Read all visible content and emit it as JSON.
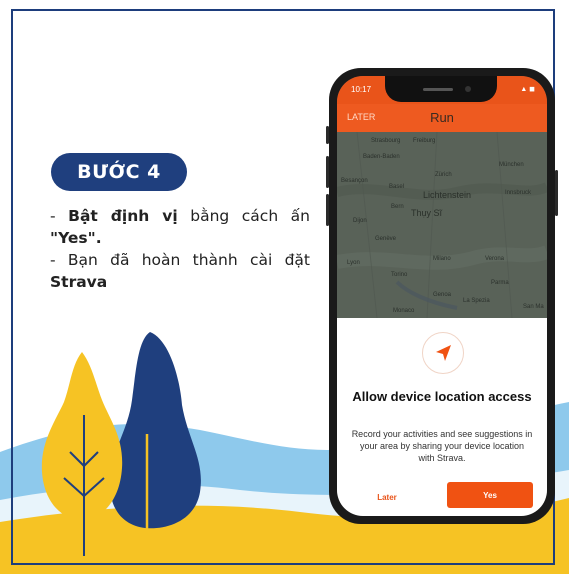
{
  "step_badge": "BƯỚC 4",
  "instructions": {
    "line1_prefix": "- ",
    "line1_bold": "Bật định vị",
    "line1_rest": " bằng cách ấn ",
    "line1_quote": "\"Yes\".",
    "line2_prefix": "- Bạn đã hoàn thành cài đặt ",
    "line2_bold": "Strava"
  },
  "phone": {
    "status_time": "10:17",
    "status_icons": "▲",
    "appbar": {
      "later": "LATER",
      "title": "Run"
    },
    "map_labels": [
      "Strasbourg",
      "Freiburg",
      "Baden-Baden",
      "München",
      "Besançon",
      "Basel",
      "Zürich",
      "Lichtenstein",
      "Innsbruck",
      "Bern",
      "Thụy Sĩ",
      "Dijon",
      "Lyon",
      "Genève",
      "Milano",
      "Verona",
      "Torino",
      "Genoa",
      "Parma",
      "La Spezia",
      "San Ma",
      "Monaco"
    ],
    "sheet": {
      "icon": "navigation-arrow-icon",
      "title": "Allow device location access",
      "body": "Record your activities and see suggestions in your area by sharing your device location with Strava.",
      "later_button": "Later",
      "yes_button": "Yes"
    }
  },
  "colors": {
    "navy": "#1f3f7e",
    "sky": "#8ec9ec",
    "yellow": "#f6c324",
    "strava_orange": "#f05212"
  }
}
